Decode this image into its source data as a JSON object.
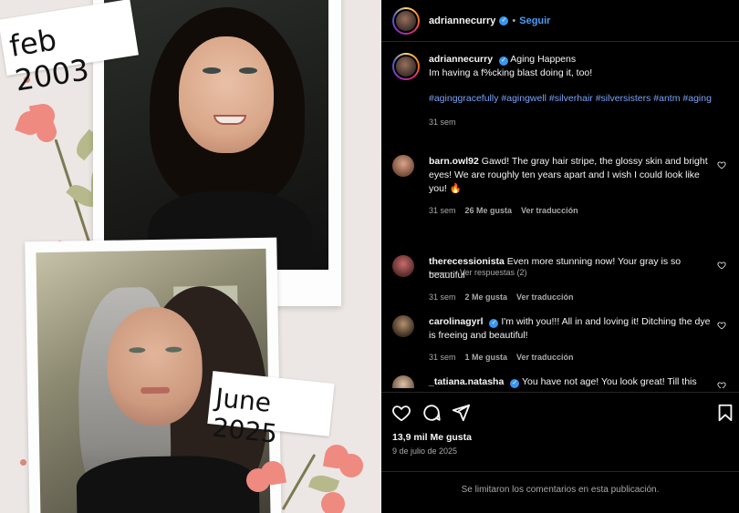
{
  "media": {
    "label_top": "feb 2003",
    "label_bottom": "June 2025"
  },
  "header": {
    "username": "adriannecurry",
    "separator": "•",
    "follow_label": "Seguir"
  },
  "caption": {
    "username": "adriannecurry",
    "title": "Aging Happens",
    "text": "Im having a f%cking blast doing it, too!",
    "hashtags": "#aginggracefully #agingwell #silverhair #silversisters #antm #aging",
    "time": "31 sem"
  },
  "comments": [
    {
      "username": "barn.owl92",
      "text": "Gawd! The gray hair stripe, the glossy skin and bright eyes! We are roughly ten years apart and I wish I could look like you! 🔥",
      "time": "31 sem",
      "likes": "26 Me gusta",
      "translate": "Ver traducción"
    },
    {
      "username": "therecessionista",
      "text": "Even more stunning now! Your gray is so beautiful",
      "time": "31 sem",
      "likes": "2 Me gusta",
      "translate": "Ver traducción"
    },
    {
      "username": "carolinagyrl",
      "text": "I'm with you!!! All in and loving it! Ditching the dye is freeing and beautiful!",
      "time": "31 sem",
      "likes": "1 Me gusta",
      "translate": "Ver traducción"
    },
    {
      "username": "_tatiana.natasha",
      "text": "You have not age! You look great! Till this"
    }
  ],
  "replies_label": "Ver respuestas (2)",
  "stats": {
    "likes": "13,9 mil Me gusta",
    "date": "9 de julio de 2025"
  },
  "footer": {
    "text": "Se limitaron los comentarios en esta publicación."
  },
  "colors": {
    "link": "#4a9df8",
    "hashtag": "#7aa2f7",
    "verified": "#3897f0",
    "background": "#000000",
    "muted": "#a8a8a8"
  }
}
